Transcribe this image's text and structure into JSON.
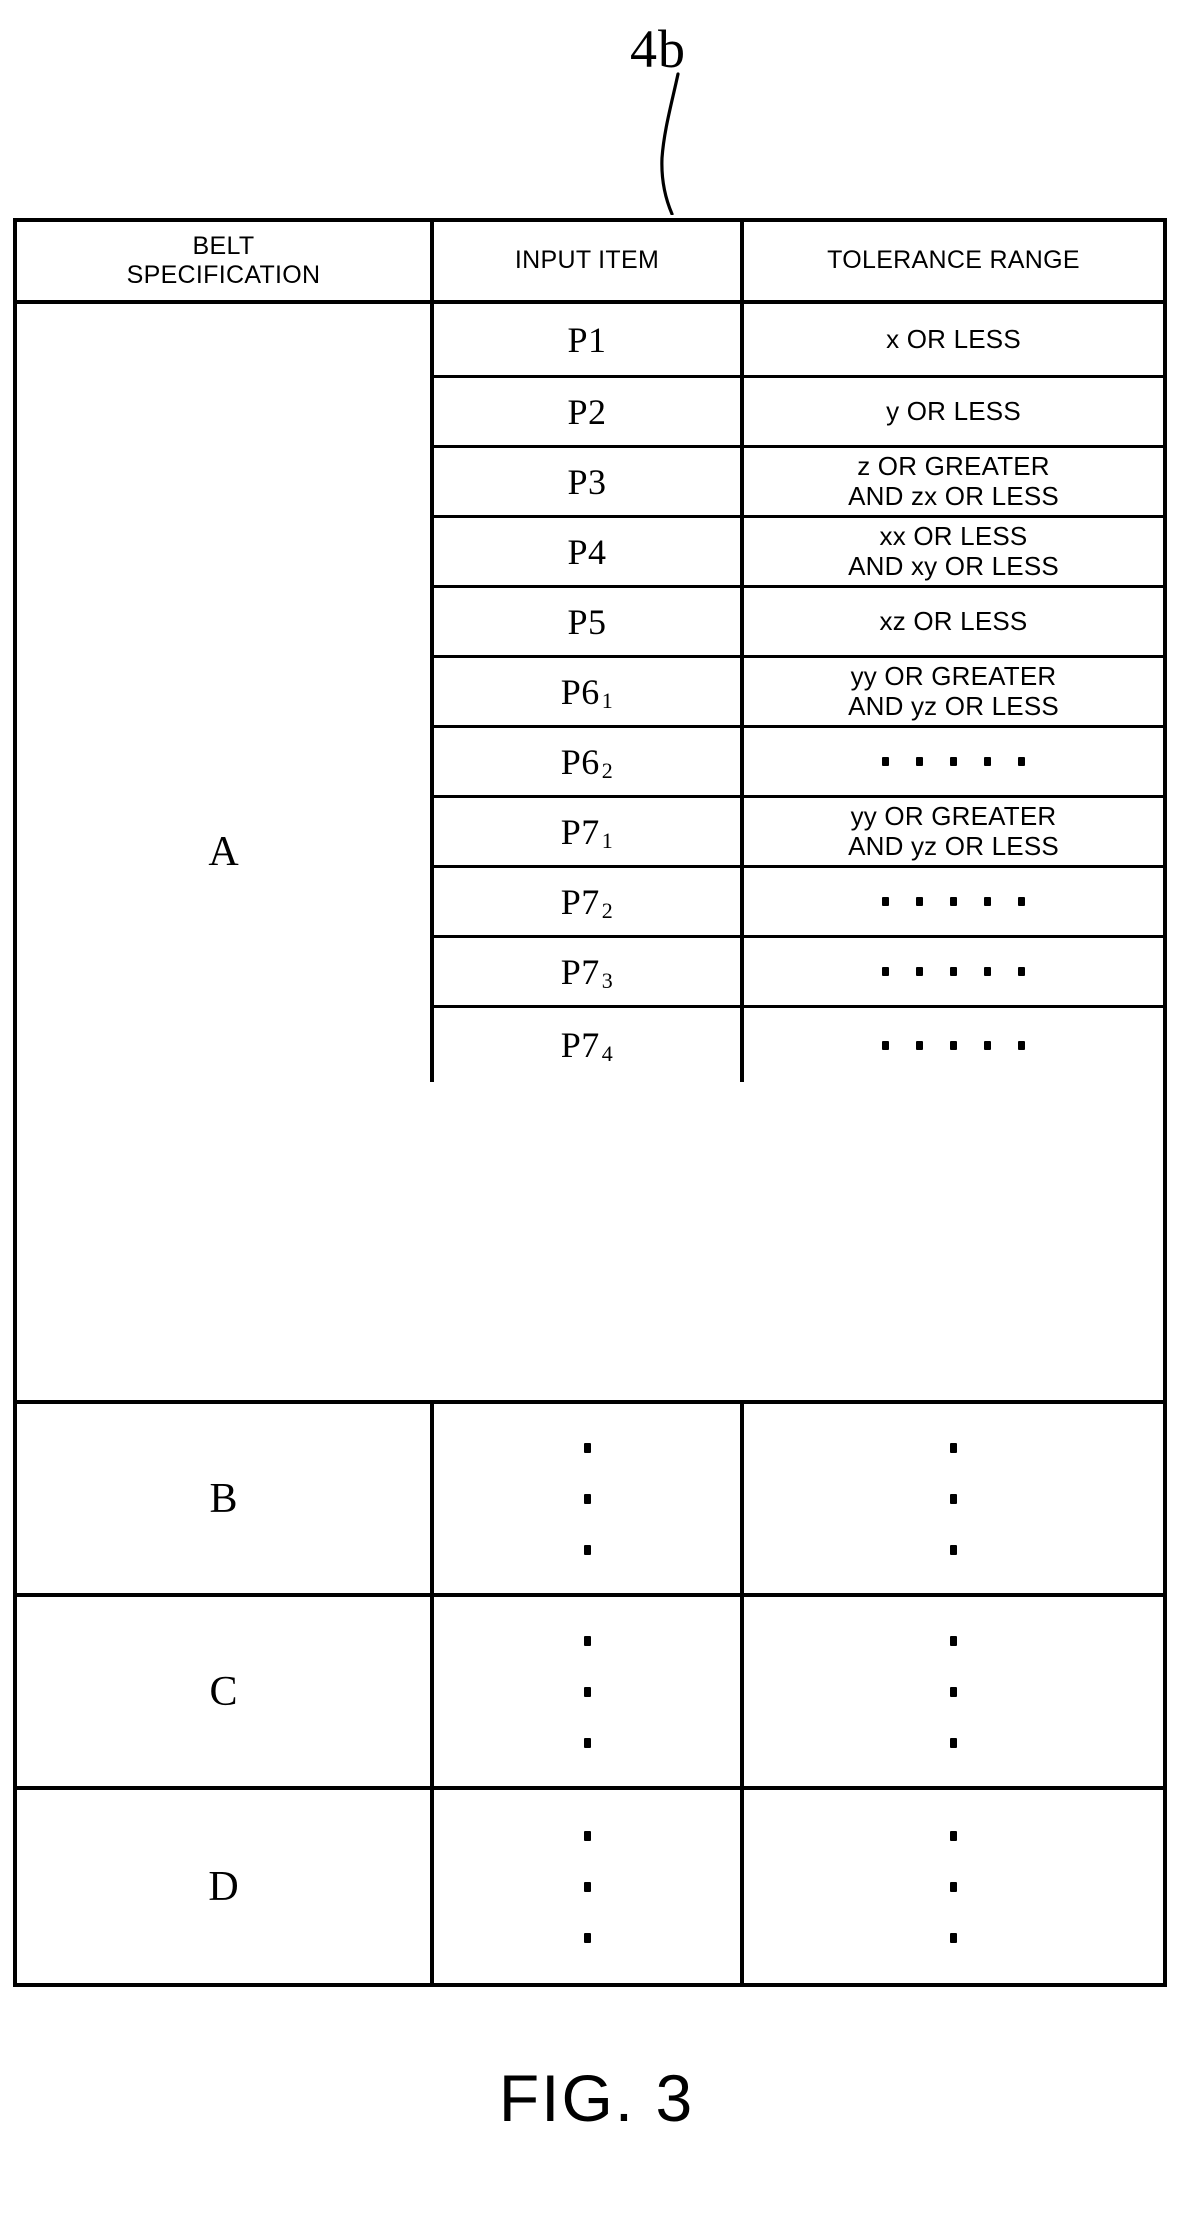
{
  "figure": {
    "reference_numeral": "4b",
    "caption": "FIG. 3"
  },
  "table": {
    "headers": {
      "col1_line1": "BELT",
      "col1_line2": "SPECIFICATION",
      "col2": "INPUT ITEM",
      "col3": "TOLERANCE RANGE"
    },
    "groups": [
      {
        "spec": "A",
        "rows": [
          {
            "item": "P1",
            "item_base": "P1",
            "item_sub": "",
            "tolerance": "x OR LESS",
            "tolerance_type": "text"
          },
          {
            "item": "P2",
            "item_base": "P2",
            "item_sub": "",
            "tolerance": "y OR LESS",
            "tolerance_type": "text"
          },
          {
            "item": "P3",
            "item_base": "P3",
            "item_sub": "",
            "tolerance": "z OR GREATER\nAND zx OR LESS",
            "tolerance_type": "text"
          },
          {
            "item": "P4",
            "item_base": "P4",
            "item_sub": "",
            "tolerance": "xx OR LESS\nAND xy OR LESS",
            "tolerance_type": "text"
          },
          {
            "item": "P5",
            "item_base": "P5",
            "item_sub": "",
            "tolerance": "xz OR LESS",
            "tolerance_type": "text"
          },
          {
            "item": "P6 1",
            "item_base": "P6",
            "item_sub": "1",
            "tolerance": "yy OR GREATER\nAND yz OR LESS",
            "tolerance_type": "text"
          },
          {
            "item": "P6 2",
            "item_base": "P6",
            "item_sub": "2",
            "tolerance": "",
            "tolerance_type": "dots-horizontal"
          },
          {
            "item": "P7 1",
            "item_base": "P7",
            "item_sub": "1",
            "tolerance": "yy OR GREATER\nAND yz OR LESS",
            "tolerance_type": "text"
          },
          {
            "item": "P7 2",
            "item_base": "P7",
            "item_sub": "2",
            "tolerance": "",
            "tolerance_type": "dots-horizontal"
          },
          {
            "item": "P7 3",
            "item_base": "P7",
            "item_sub": "3",
            "tolerance": "",
            "tolerance_type": "dots-horizontal"
          },
          {
            "item": "P7 4",
            "item_base": "P7",
            "item_sub": "4",
            "tolerance": "",
            "tolerance_type": "dots-horizontal"
          }
        ]
      },
      {
        "spec": "B",
        "item_type": "dots-vertical",
        "tolerance_type": "dots-vertical"
      },
      {
        "spec": "C",
        "item_type": "dots-vertical",
        "tolerance_type": "dots-vertical"
      },
      {
        "spec": "D",
        "item_type": "dots-vertical",
        "tolerance_type": "dots-vertical"
      }
    ]
  }
}
